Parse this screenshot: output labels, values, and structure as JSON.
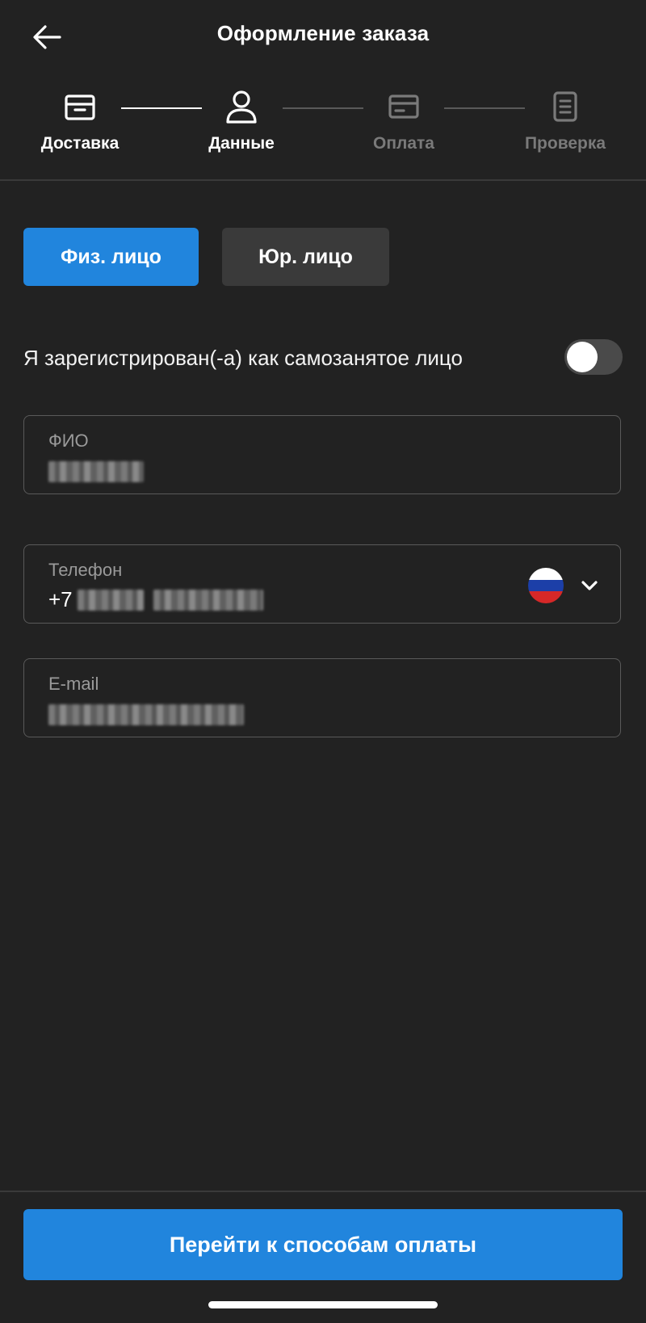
{
  "header": {
    "title": "Оформление заказа",
    "back_icon": "arrow-left-icon"
  },
  "stepper": {
    "steps": [
      {
        "label": "Доставка",
        "icon": "box-icon",
        "state": "done"
      },
      {
        "label": "Данные",
        "icon": "user-icon",
        "state": "active"
      },
      {
        "label": "Оплата",
        "icon": "card-icon",
        "state": "inactive"
      },
      {
        "label": "Проверка",
        "icon": "document-icon",
        "state": "inactive"
      }
    ]
  },
  "customer_type": {
    "options": [
      "Физ. лицо",
      "Юр. лицо"
    ],
    "selected": "Физ. лицо"
  },
  "self_employed": {
    "label": "Я зарегистрирован(-а) как самозанятое лицо",
    "enabled": false
  },
  "form": {
    "name": {
      "label": "ФИО"
    },
    "phone": {
      "label": "Телефон",
      "prefix": "+7",
      "country_flag": "russia-flag-icon"
    },
    "email": {
      "label": "E-mail"
    }
  },
  "footer": {
    "primary_label": "Перейти к способам оплаты"
  },
  "colors": {
    "background": "#222222",
    "accent": "#2185dd",
    "inactive_text": "#7a7a7a",
    "border": "#5a5a5a"
  }
}
